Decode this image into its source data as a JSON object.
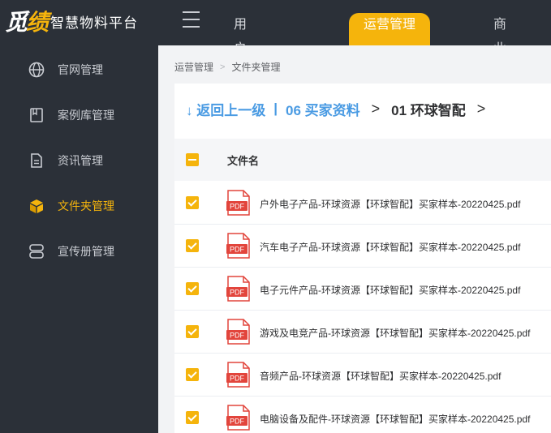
{
  "brand": {
    "logo_mark_a": "觅",
    "logo_mark_b": "绩",
    "name": "智慧物料平台"
  },
  "topnav": {
    "items": [
      "用户管理",
      "运营管理",
      "商业智能"
    ],
    "active": "运营管理"
  },
  "sidebar": {
    "items": [
      {
        "label": "官网管理",
        "icon": "globe-icon"
      },
      {
        "label": "案例库管理",
        "icon": "bookmark-icon"
      },
      {
        "label": "资讯管理",
        "icon": "document-icon"
      },
      {
        "label": "文件夹管理",
        "icon": "box-icon"
      },
      {
        "label": "宣传册管理",
        "icon": "layers-icon"
      }
    ],
    "active": "文件夹管理"
  },
  "breadcrumb": {
    "parent": "运营管理",
    "current": "文件夹管理"
  },
  "path": {
    "back": "返回上一级",
    "parent": "06 买家资料",
    "current": "01 环球智配"
  },
  "table": {
    "column_name": "文件名",
    "files": [
      "户外电子产品-环球资源【环球智配】买家样本-20220425.pdf",
      "汽车电子产品-环球资源【环球智配】买家样本-20220425.pdf",
      "电子元件产品-环球资源【环球智配】买家样本-20220425.pdf",
      "游戏及电竞产品-环球资源【环球智配】买家样本-20220425.pdf",
      "音频产品-环球资源【环球智配】买家样本-20220425.pdf",
      "电脑设备及配件-环球资源【环球智配】买家样本-20220425.pdf"
    ],
    "file_icon_label": "PDF"
  },
  "colors": {
    "accent": "#f5b40c",
    "link": "#4a9be3",
    "dark": "#2b3038",
    "pdf": "#e2453c"
  }
}
